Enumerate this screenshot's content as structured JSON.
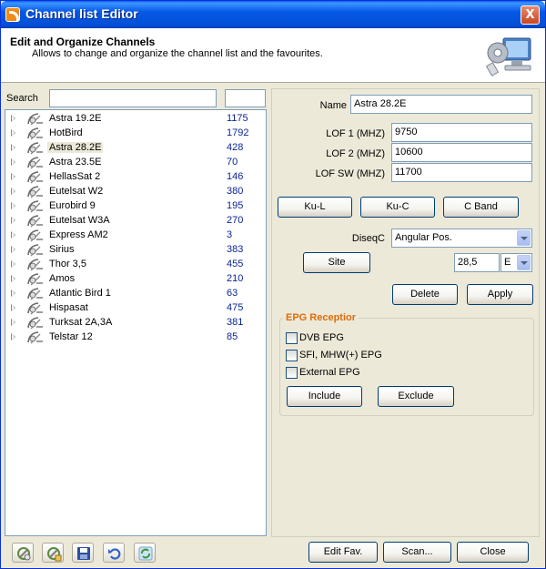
{
  "window": {
    "title": "Channel list Editor",
    "close_symbol": "X"
  },
  "header": {
    "title": "Edit and Organize Channels",
    "subtitle": "Allows to change and organize the channel list and the favourites.",
    "icon": "computer-settings-icon"
  },
  "search": {
    "label": "Search",
    "value": "",
    "value2": ""
  },
  "satellites": [
    {
      "name": "Astra 19.2E",
      "count": "1175"
    },
    {
      "name": "HotBird",
      "count": "1792"
    },
    {
      "name": "Astra 28.2E",
      "count": "428",
      "selected": true
    },
    {
      "name": "Astra 23.5E",
      "count": "70"
    },
    {
      "name": "HellasSat 2",
      "count": "146"
    },
    {
      "name": "Eutelsat W2",
      "count": "380"
    },
    {
      "name": "Eurobird 9",
      "count": "195"
    },
    {
      "name": "Eutelsat W3A",
      "count": "270"
    },
    {
      "name": "Express AM2",
      "count": "3"
    },
    {
      "name": "Sirius",
      "count": "383"
    },
    {
      "name": "Thor 3,5",
      "count": "455"
    },
    {
      "name": "Amos",
      "count": "210"
    },
    {
      "name": "Atlantic Bird 1",
      "count": "63"
    },
    {
      "name": "Hispasat",
      "count": "475"
    },
    {
      "name": "Turksat 2A,3A",
      "count": "381"
    },
    {
      "name": "Telstar 12",
      "count": "85"
    }
  ],
  "form": {
    "name_label": "Name",
    "name_value": "Astra 28.2E",
    "lof1_label": "LOF 1 (MHZ)",
    "lof1_value": "9750",
    "lof2_label": "LOF 2 (MHZ)",
    "lof2_value": "10600",
    "lofsw_label": "LOF SW (MHZ)",
    "lofsw_value": "11700",
    "band_buttons": [
      "Ku-L",
      "Ku-C",
      "C Band"
    ],
    "diseqc_label": "DiseqC",
    "diseqc_value": "Angular Pos.",
    "site_label": "Site",
    "site_value": "28,5",
    "direction_value": "E",
    "delete_label": "Delete",
    "apply_label": "Apply"
  },
  "epg": {
    "title": "EPG Receptior",
    "options": [
      "DVB EPG",
      "SFI, MHW(+) EPG",
      "External EPG"
    ],
    "include_label": "Include",
    "exclude_label": "Exclude"
  },
  "footer": {
    "tools": [
      "add-satellite-icon",
      "edit-satellite-icon",
      "save-icon",
      "undo-icon",
      "refresh-icon"
    ],
    "edit_fav_label": "Edit Fav.",
    "scan_label": "Scan...",
    "close_label": "Close"
  }
}
